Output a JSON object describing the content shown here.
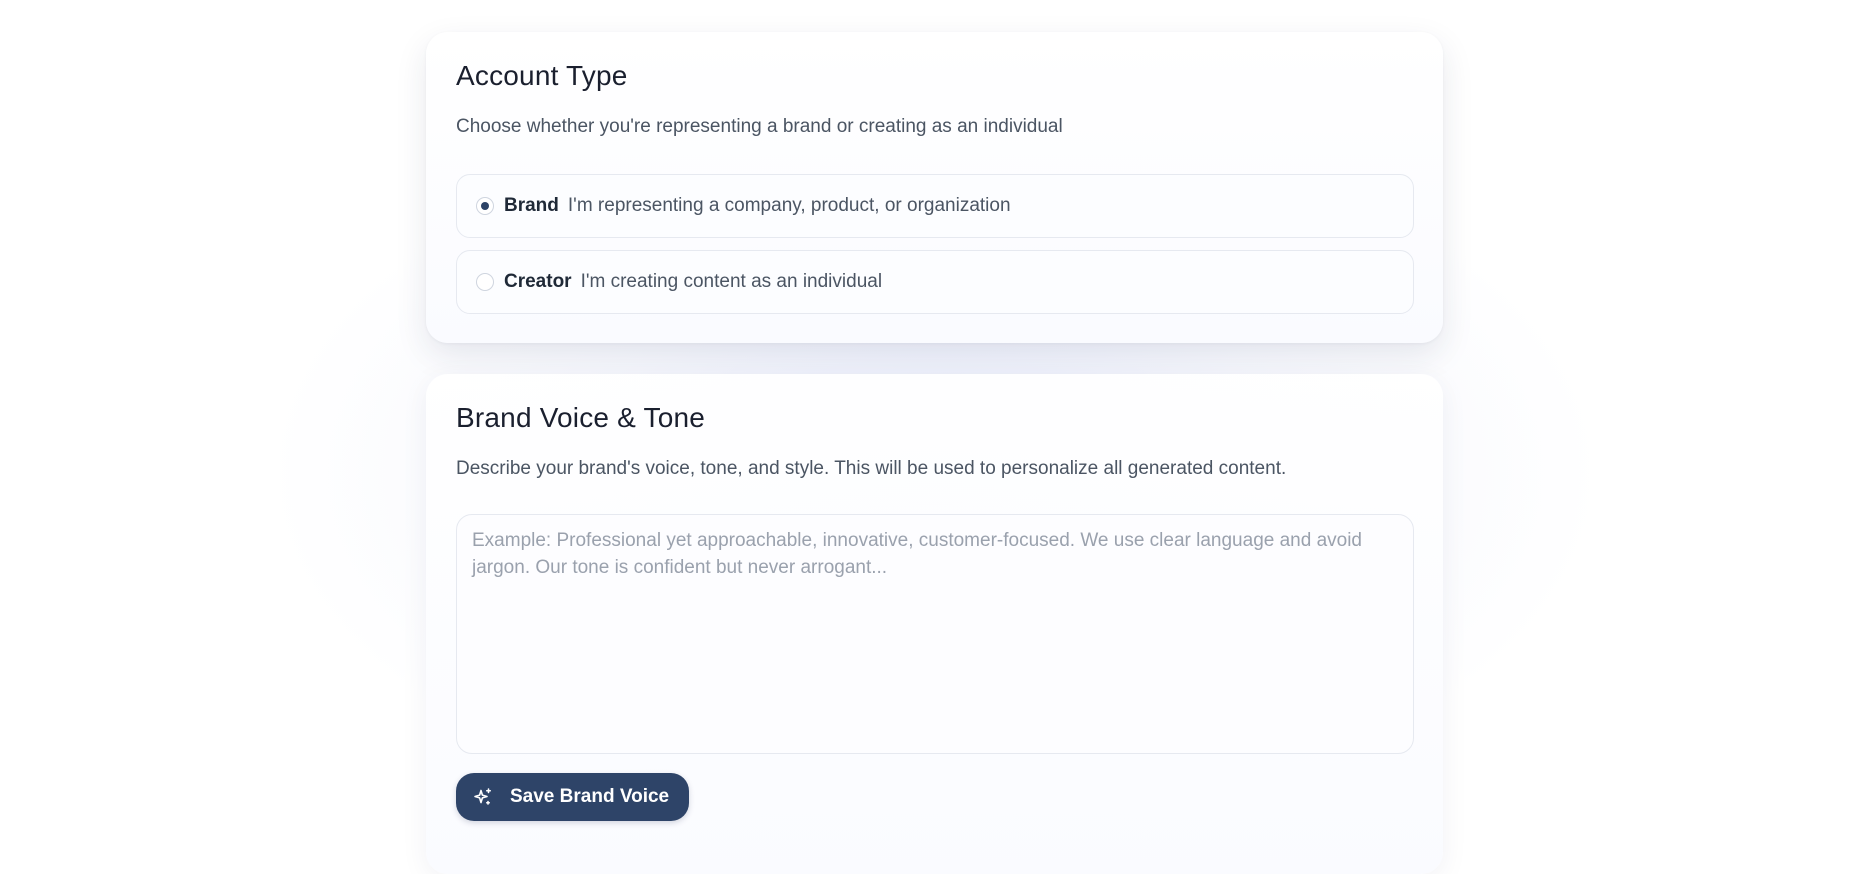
{
  "account_type": {
    "title": "Account Type",
    "description": "Choose whether you're representing a brand or creating as an individual",
    "options": [
      {
        "label": "Brand",
        "description": "I'm representing a company, product, or organization",
        "selected": true
      },
      {
        "label": "Creator",
        "description": "I'm creating content as an individual",
        "selected": false
      }
    ]
  },
  "brand_voice": {
    "title": "Brand Voice & Tone",
    "description": "Describe your brand's voice, tone, and style. This will be used to personalize all generated content.",
    "textarea": {
      "value": "",
      "placeholder": "Example: Professional yet approachable, innovative, customer-focused. We use clear language and avoid jargon. Our tone is confident but never arrogant..."
    },
    "save_label": "Save Brand Voice",
    "save_icon": "sparkles-icon"
  },
  "colors": {
    "accent": "#2e4468",
    "radio_selected": "#2c4266",
    "border": "#e6e9f0"
  }
}
